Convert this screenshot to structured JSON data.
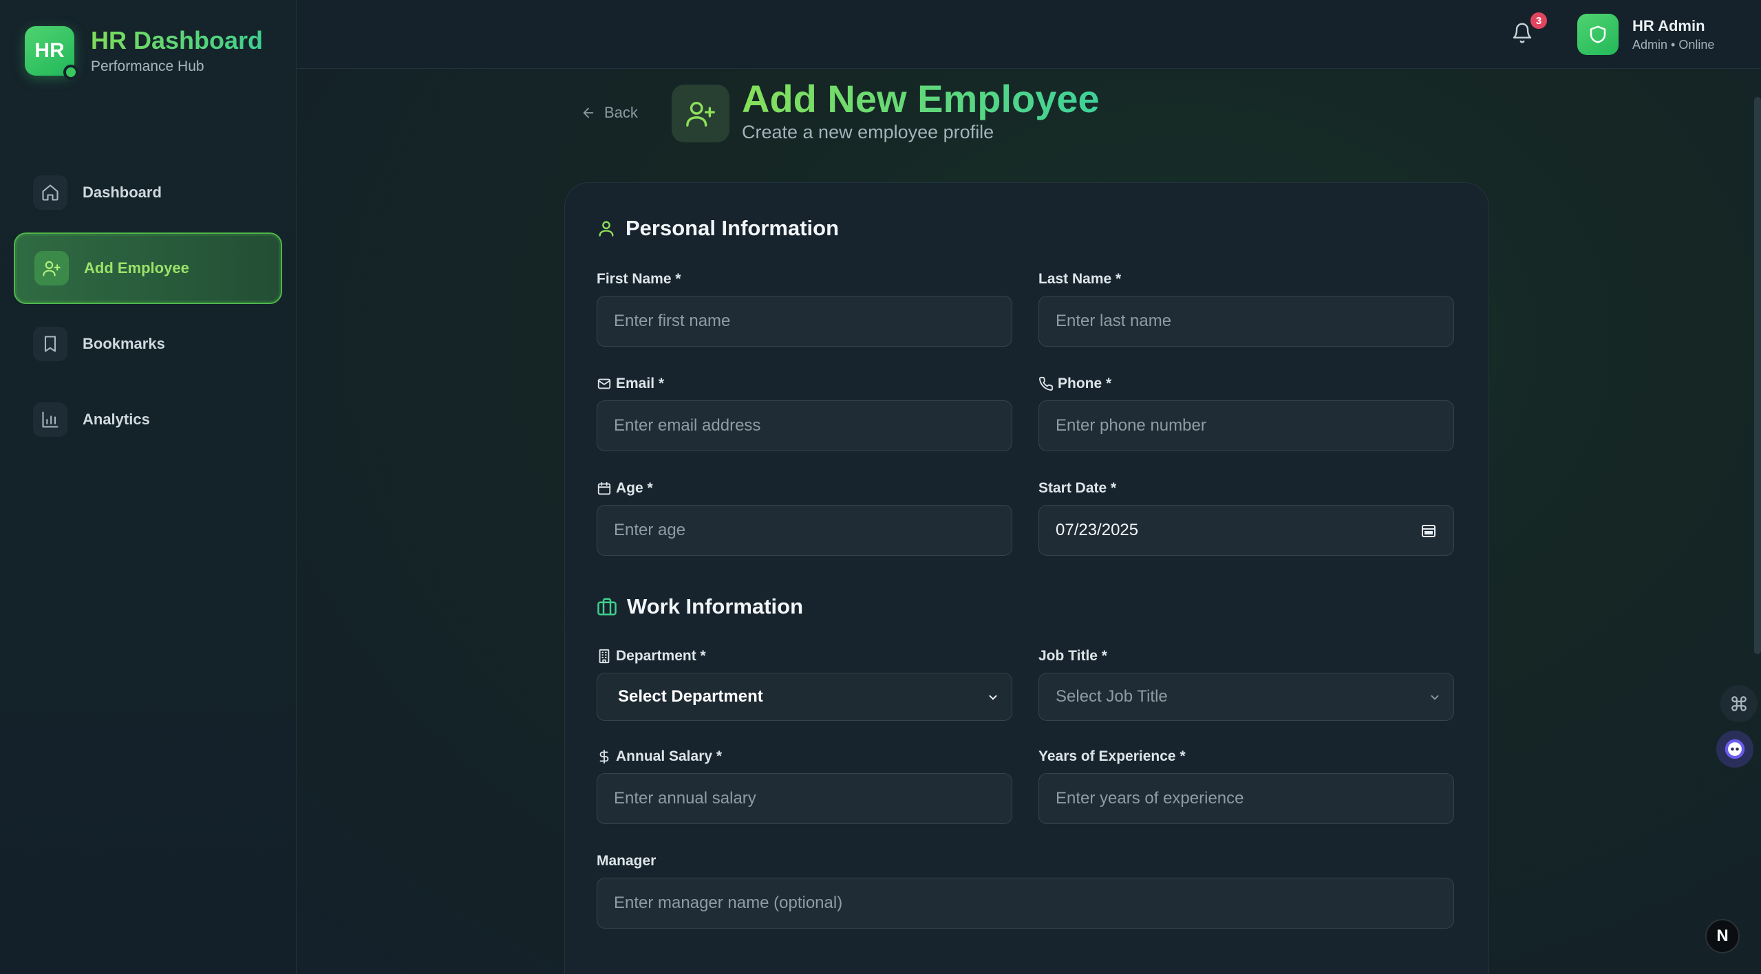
{
  "brand": {
    "logo_text": "HR",
    "title": "HR Dashboard",
    "subtitle": "Performance Hub"
  },
  "sidebar": {
    "items": [
      {
        "label": "Dashboard",
        "icon": "home-icon",
        "active": false
      },
      {
        "label": "Add Employee",
        "icon": "user-plus-icon",
        "active": true
      },
      {
        "label": "Bookmarks",
        "icon": "bookmark-icon",
        "active": false
      },
      {
        "label": "Analytics",
        "icon": "bar-chart-icon",
        "active": false
      }
    ]
  },
  "topbar": {
    "notification_count": "3",
    "user_name": "HR Admin",
    "user_status": "Admin • Online"
  },
  "page": {
    "back_label": "Back",
    "title": "Add New Employee",
    "subtitle": "Create a new employee profile"
  },
  "personal": {
    "section_title": "Personal Information",
    "first_name": {
      "label": "First Name *",
      "placeholder": "Enter first name"
    },
    "last_name": {
      "label": "Last Name *",
      "placeholder": "Enter last name"
    },
    "email": {
      "label": "Email *",
      "placeholder": "Enter email address"
    },
    "phone": {
      "label": "Phone *",
      "placeholder": "Enter phone number"
    },
    "age": {
      "label": "Age *",
      "placeholder": "Enter age"
    },
    "start_date": {
      "label": "Start Date *",
      "value": "07/23/2025"
    }
  },
  "work": {
    "section_title": "Work Information",
    "department": {
      "label": "Department *",
      "value": "Select Department"
    },
    "job_title": {
      "label": "Job Title *",
      "value": "Select Job Title"
    },
    "salary": {
      "label": "Annual Salary *",
      "placeholder": "Enter annual salary"
    },
    "experience": {
      "label": "Years of Experience *",
      "placeholder": "Enter years of experience"
    },
    "manager": {
      "label": "Manager",
      "placeholder": "Enter manager name (optional)"
    }
  },
  "next_badge": "N",
  "colors": {
    "accent_green": "#4fd36f",
    "active_label": "#9be36a",
    "badge_red": "#e0455f",
    "background": "#142026"
  }
}
